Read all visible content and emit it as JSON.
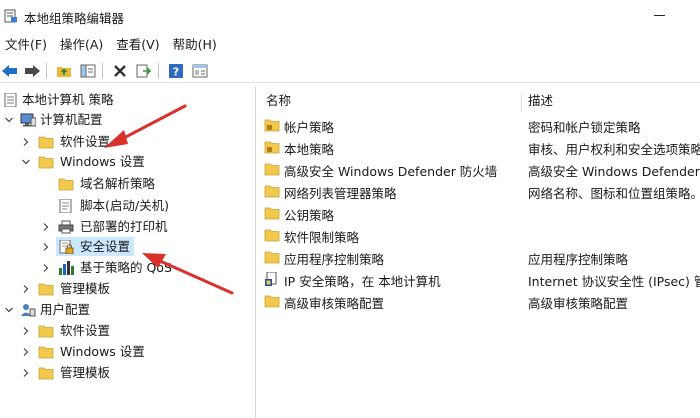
{
  "window": {
    "title": "本地组策略编辑器"
  },
  "menu": [
    {
      "label": "文件(F)"
    },
    {
      "label": "操作(A)"
    },
    {
      "label": "查看(V)"
    },
    {
      "label": "帮助(H)"
    }
  ],
  "toolbar": {
    "buttons": [
      "back-arrow-icon",
      "forward-arrow-icon",
      "up-folder-icon",
      "show-hide-tree-icon",
      "delete-icon",
      "export-list-icon",
      "help-icon",
      "properties-icon"
    ]
  },
  "tree": {
    "items": [
      {
        "label": "本地计算机 策略",
        "icon": "policy-doc-icon"
      },
      {
        "label": "计算机配置",
        "icon": "computer-icon"
      },
      {
        "label": "软件设置",
        "icon": "folder-icon"
      },
      {
        "label": "Windows 设置",
        "icon": "folder-icon"
      },
      {
        "label": "域名解析策略",
        "icon": "folder-icon"
      },
      {
        "label": "脚本(启动/关机)",
        "icon": "script-icon"
      },
      {
        "label": "已部署的打印机",
        "icon": "printer-icon"
      },
      {
        "label": "安全设置",
        "icon": "security-icon"
      },
      {
        "label": "基于策略的 QoS",
        "icon": "chart-icon"
      },
      {
        "label": "管理模板",
        "icon": "folder-icon"
      },
      {
        "label": "用户配置",
        "icon": "user-icon"
      },
      {
        "label": "软件设置",
        "icon": "folder-icon"
      },
      {
        "label": "Windows 设置",
        "icon": "folder-icon"
      },
      {
        "label": "管理模板",
        "icon": "folder-icon"
      }
    ]
  },
  "list": {
    "columns": {
      "name": "名称",
      "description": "描述"
    },
    "rows": [
      {
        "name": "帐户策略",
        "description": "密码和帐户锁定策略",
        "icon": "folder-lock-icon"
      },
      {
        "name": "本地策略",
        "description": "审核、用户权利和安全选项策略",
        "icon": "folder-lock-icon"
      },
      {
        "name": "高级安全 Windows Defender 防火墙",
        "description": "高级安全 Windows Defender 防火墙",
        "icon": "folder-icon"
      },
      {
        "name": "网络列表管理器策略",
        "description": "网络名称、图标和位置组策略。",
        "icon": "folder-icon"
      },
      {
        "name": "公钥策略",
        "description": "",
        "icon": "folder-icon"
      },
      {
        "name": "软件限制策略",
        "description": "",
        "icon": "folder-icon"
      },
      {
        "name": "应用程序控制策略",
        "description": "应用程序控制策略",
        "icon": "folder-icon"
      },
      {
        "name": "IP 安全策略，在 本地计算机",
        "description": "Internet 协议安全性 (IPsec) 管理",
        "icon": "ip-security-icon"
      },
      {
        "name": "高级审核策略配置",
        "description": "高级审核策略配置",
        "icon": "folder-icon"
      }
    ]
  },
  "colors": {
    "selection": "#cce8ff",
    "arrow": "#d9322b",
    "folder": "#f2c94c"
  }
}
